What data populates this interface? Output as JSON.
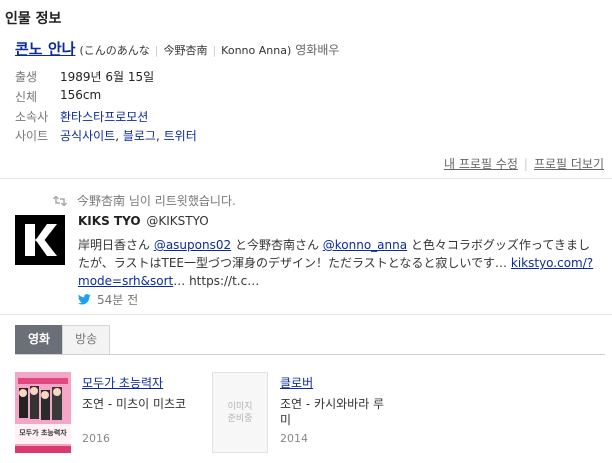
{
  "section_title": "인물 정보",
  "person": {
    "name": "콘노 안나",
    "reading": "(こんのあんな",
    "name_jp": "今野杏南",
    "name_en": "Konno Anna)",
    "occupation": "영화배우"
  },
  "info": [
    {
      "label": "출생",
      "value": "1989년 6월 15일"
    },
    {
      "label": "신체",
      "value": "156cm"
    },
    {
      "label": "소속사",
      "value": "환타스타프로모션"
    },
    {
      "label": "사이트",
      "links": [
        "공식사이트",
        "블로그",
        "트위터"
      ]
    }
  ],
  "profile_links": {
    "edit": "내 프로필 수정",
    "more": "프로필 더보기"
  },
  "tweet": {
    "retweet_notice": "今野杏南 님이 리트윗했습니다.",
    "avatar_letter": "K",
    "author_name": "KIKS TYO",
    "author_handle": "@KIKSTYO",
    "text_parts": {
      "p1": "岸明日香さん ",
      "mention1": "@asupons02",
      "p2": " と今野杏南さん ",
      "mention2": "@konno_anna",
      "p3": " と色々コラボグッズ作ってきましたが、ラストはTEE一型づつ渾身のデザイン！ただラストとなると寂しいです… ",
      "link1": "kikstyo.com/?mode=srh&sort",
      "p4": "… https://t.c…"
    },
    "time": "54분 전"
  },
  "tabs": [
    {
      "label": "영화",
      "active": true
    },
    {
      "label": "방송",
      "active": false
    }
  ],
  "movies": [
    {
      "title": "모두가 초능력자",
      "role": "조연 - 미츠이 미츠코",
      "year": "2016",
      "poster_text": "모두가 초능력자"
    },
    {
      "title": "클로버",
      "role": "조연 - 카시와바라 루미",
      "year": "2014",
      "no_image_text": "이미지\n준비중"
    }
  ],
  "colors": {
    "link": "#0b2b9c",
    "tab_active": "#6a6f78",
    "twitter": "#1da1f2"
  }
}
